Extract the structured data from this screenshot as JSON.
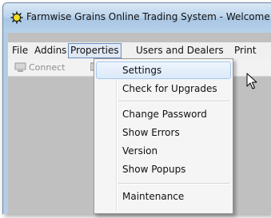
{
  "window": {
    "title": "Farmwise Grains Online Trading System - Welcome"
  },
  "menubar": {
    "items": [
      {
        "label": "File"
      },
      {
        "label": "Addins"
      },
      {
        "label": "Properties"
      },
      {
        "label": "Users and Dealers"
      },
      {
        "label": "Print"
      }
    ]
  },
  "toolbar": {
    "connect_label": "Connect"
  },
  "properties_menu": {
    "items": [
      {
        "label": "Settings"
      },
      {
        "label": "Check for Upgrades"
      },
      {
        "label": "Change Password"
      },
      {
        "label": "Show Errors"
      },
      {
        "label": "Version"
      },
      {
        "label": "Show Popups"
      },
      {
        "label": "Maintenance"
      }
    ]
  },
  "colors": {
    "menu_highlight": "#dbe9f9",
    "client_background": "#c0c0c0",
    "titlebar": "#bcd4ec"
  },
  "icons": {
    "app": "sun-icon",
    "toolbar": "monitor-icon",
    "cursor": "mouse-pointer-icon"
  }
}
